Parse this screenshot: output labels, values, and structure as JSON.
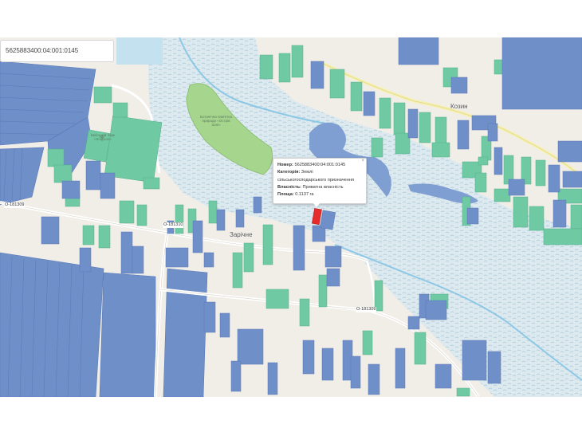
{
  "search": {
    "value": "5625883400:04:001:0145"
  },
  "colors": {
    "background": "#f1eee8",
    "state_land": "#6f8fc9",
    "private_land": "#6fcaa4",
    "water": "#dce9ef",
    "forest": "#a6d58e",
    "parcel_selected": "#e52b2b"
  },
  "labels": {
    "place_kozyn": "Козин",
    "place_zarichne": "Зарічне",
    "road_1": "О-181309",
    "road_2": "О-181310",
    "road_3": "О-181309",
    "poi_park": "Ботанічна пам'ятка природи «Острів Зоні»",
    "poi_church": "Шкільний парк «Костьол»"
  },
  "popup": {
    "number_label": "Номер:",
    "number_value": "5625883400:04:001:0145",
    "category_label": "Категорія:",
    "category_value_1": "Землі",
    "category_value_2": "сільськогосподарського призначення",
    "ownership_label": "Власність:",
    "ownership_value": "Приватна власність",
    "area_label": "Площа:",
    "area_value": "0.1137 га",
    "close_icon": "×"
  }
}
